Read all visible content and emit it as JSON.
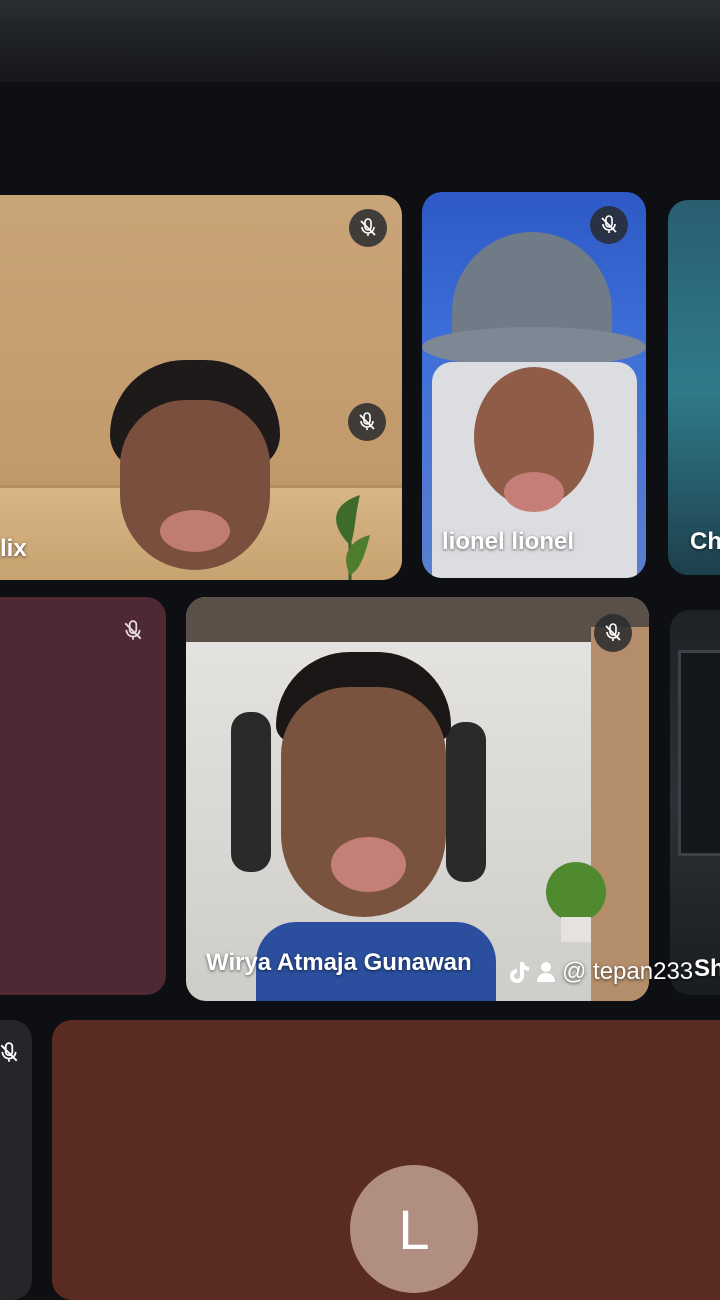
{
  "participants": [
    {
      "id": "felix",
      "name": "lix",
      "muted": true
    },
    {
      "id": "lionel",
      "name": "lionel lionel",
      "muted": true
    },
    {
      "id": "ch",
      "name": "Ch",
      "muted": false
    },
    {
      "id": "maroon",
      "name": "",
      "muted": true
    },
    {
      "id": "wirya",
      "name": "Wirya Atmaja Gunawan",
      "muted": true
    },
    {
      "id": "sh",
      "name": "Sh",
      "muted": false
    },
    {
      "id": "left-edge",
      "name": "",
      "muted": true
    },
    {
      "id": "l-tile",
      "name": "",
      "muted": false,
      "avatar_letter": "L"
    }
  ],
  "watermark": {
    "icons": [
      "tiktok-icon",
      "person-icon"
    ],
    "handle": "@ tepan233"
  },
  "colors": {
    "background": "#0d0f12",
    "maroon_tile": "#4e2832",
    "brown_tile": "#5a2b22",
    "avatar": "#b08f82"
  }
}
